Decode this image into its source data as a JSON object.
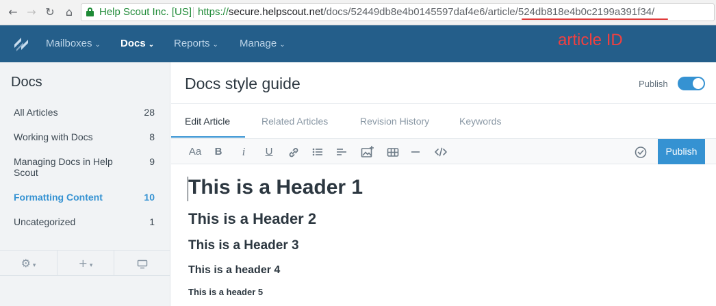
{
  "browser": {
    "org": "Help Scout Inc. [US]",
    "url_scheme": "https://",
    "url_host": "secure.helpscout.net",
    "url_path": "/docs/52449db8e4b0145597daf4e6/article/524db818e4b0c2199a391f34/"
  },
  "annotation": "article ID",
  "topnav": {
    "items": [
      {
        "label": "Mailboxes"
      },
      {
        "label": "Docs"
      },
      {
        "label": "Reports"
      },
      {
        "label": "Manage"
      }
    ]
  },
  "sidebar": {
    "title": "Docs",
    "items": [
      {
        "label": "All Articles",
        "count": "28"
      },
      {
        "label": "Working with Docs",
        "count": "8"
      },
      {
        "label": "Managing Docs in Help Scout",
        "count": "9"
      },
      {
        "label": "Formatting Content",
        "count": "10"
      },
      {
        "label": "Uncategorized",
        "count": "1"
      }
    ]
  },
  "main": {
    "title": "Docs style guide",
    "publish_label": "Publish",
    "publish_on": true,
    "tabs": [
      {
        "label": "Edit Article"
      },
      {
        "label": "Related Articles"
      },
      {
        "label": "Revision History"
      },
      {
        "label": "Keywords"
      }
    ],
    "toolbar": {
      "font_size_label": "Aa",
      "bold_label": "B",
      "italic_label": "i",
      "underline_label": "U",
      "publish_button": "Publish"
    },
    "content": {
      "h1": "This is a Header 1",
      "h2": "This is a Header 2",
      "h3": "This is a Header 3",
      "h4": "This is a header 4",
      "h5": "This is a header 5"
    }
  },
  "colors": {
    "nav_bg": "#245e8a",
    "accent": "#3592d2",
    "annotation": "#f04040"
  }
}
